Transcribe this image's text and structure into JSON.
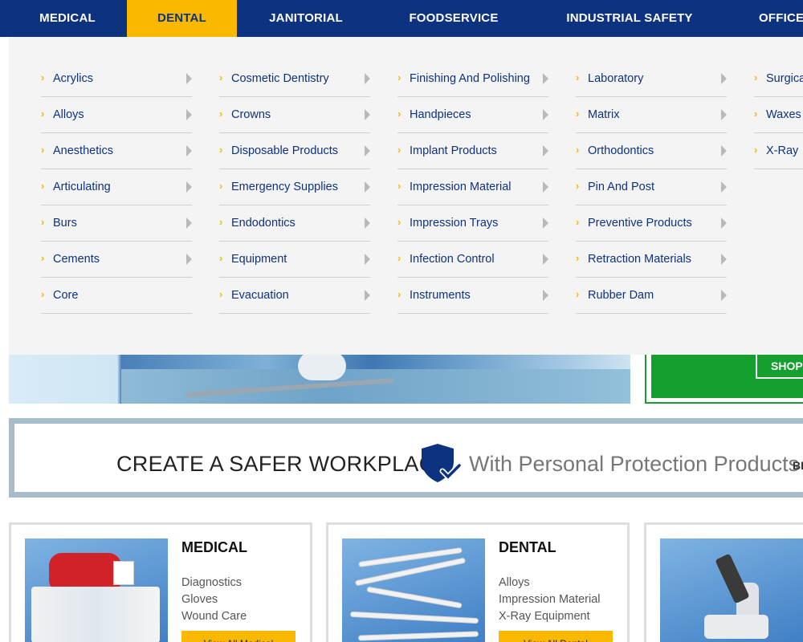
{
  "nav": {
    "items": [
      {
        "label": "MEDICAL",
        "active": false
      },
      {
        "label": "DENTAL",
        "active": true
      },
      {
        "label": "JANITORIAL",
        "active": false
      },
      {
        "label": "FOODSERVICE",
        "active": false
      },
      {
        "label": "INDUSTRIAL SAFETY",
        "active": false
      },
      {
        "label": "OFFICE",
        "active": false
      }
    ]
  },
  "mega_menu": {
    "columns": [
      [
        "Acrylics",
        "Alloys",
        "Anesthetics",
        "Articulating",
        "Burs",
        "Cements",
        "Core"
      ],
      [
        "Cosmetic Dentistry",
        "Crowns",
        "Disposable Products",
        "Emergency Supplies",
        "Endodontics",
        "Equipment",
        "Evacuation"
      ],
      [
        "Finishing And Polishing",
        "Handpieces",
        "Implant Products",
        "Impression Material",
        "Impression Trays",
        "Infection Control",
        "Instruments"
      ],
      [
        "Laboratory",
        "Matrix",
        "Orthodontics",
        "Pin And Post",
        "Preventive Products",
        "Retraction Materials",
        "Rubber Dam"
      ],
      [
        "Surgical",
        "Waxes",
        "X-Ray"
      ]
    ]
  },
  "hero": {
    "shop_button": "SHOP N",
    "accent_color": "#14a02f"
  },
  "promo": {
    "lead": "CREATE A SAFER WORKPLACE",
    "tail": "With Personal Protection Products",
    "cut_label": "BR"
  },
  "cards": [
    {
      "title": "MEDICAL",
      "links": [
        "Diagnostics",
        "Gloves",
        "Wound Care"
      ],
      "cta": "View All Medical"
    },
    {
      "title": "DENTAL",
      "links": [
        "Alloys",
        "Impression Material",
        "X-Ray Equipment"
      ],
      "cta": "View All Dental"
    },
    {
      "title": "",
      "links": [],
      "cta": ""
    }
  ],
  "colors": {
    "nav_bg": "#0d3280",
    "accent": "#fbb800",
    "link": "#0d3280"
  }
}
